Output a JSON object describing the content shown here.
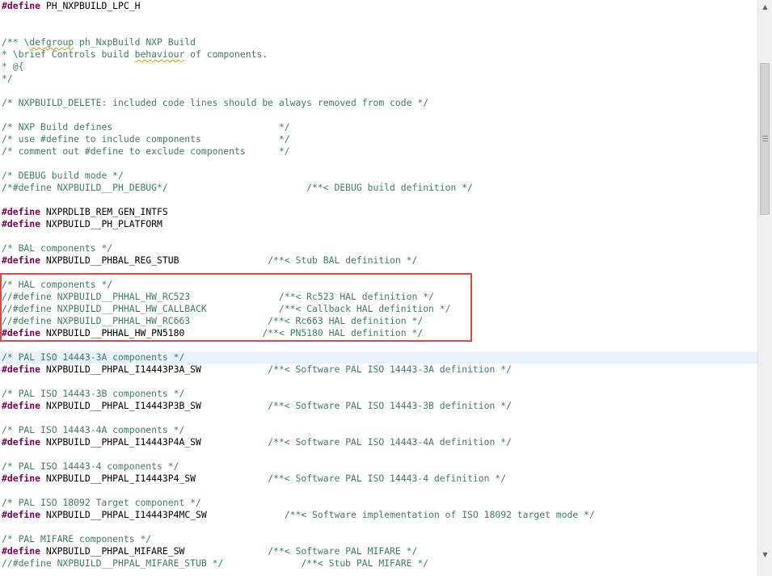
{
  "lines": [
    [
      {
        "t": "#define",
        "c": "kw"
      },
      {
        "t": " PH_NXPBUILD_LPC_H",
        "c": "id"
      }
    ],
    [],
    [],
    [
      {
        "t": "/** \\",
        "c": "cm"
      },
      {
        "t": "defgroup",
        "c": "cm",
        "sq": true
      },
      {
        "t": " ph_NxpBuild NXP Build",
        "c": "cm"
      }
    ],
    [
      {
        "t": "* \\brief Controls build ",
        "c": "cm"
      },
      {
        "t": "behaviour",
        "c": "cm",
        "sq": true
      },
      {
        "t": " of components.",
        "c": "cm"
      }
    ],
    [
      {
        "t": "* @{",
        "c": "cm"
      }
    ],
    [
      {
        "t": "*/",
        "c": "cm"
      }
    ],
    [],
    [
      {
        "t": "/* NXPBUILD_DELETE: included code lines should be always removed from code */",
        "c": "cm"
      }
    ],
    [],
    [
      {
        "t": "/* NXP Build defines                              */",
        "c": "cm"
      }
    ],
    [
      {
        "t": "/* use #define to include components              */",
        "c": "cm"
      }
    ],
    [
      {
        "t": "/* comment out #define to exclude components      */",
        "c": "cm"
      }
    ],
    [],
    [
      {
        "t": "/* DEBUG build mode */",
        "c": "cm"
      }
    ],
    [
      {
        "t": "/*#define NXPBUILD__PH_DEBUG*/                         /**< DEBUG build definition */",
        "c": "cm"
      }
    ],
    [],
    [
      {
        "t": "#define",
        "c": "kw"
      },
      {
        "t": " NXPRDLIB_REM_GEN_INTFS",
        "c": "id"
      }
    ],
    [
      {
        "t": "#define",
        "c": "kw"
      },
      {
        "t": " NXPBUILD__PH_PLATFORM",
        "c": "id"
      }
    ],
    [],
    [
      {
        "t": "/* BAL components */",
        "c": "cm"
      }
    ],
    [
      {
        "t": "#define",
        "c": "kw"
      },
      {
        "t": " NXPBUILD__PHBAL_REG_STUB                ",
        "c": "id"
      },
      {
        "t": "/**< Stub BAL definition */",
        "c": "cm"
      }
    ],
    [],
    [
      {
        "t": "/* HAL components */",
        "c": "cm"
      }
    ],
    [
      {
        "t": "//#define NXPBUILD__PHHAL_HW_RC523                /**< Rc523 HAL definition */",
        "c": "cm"
      }
    ],
    [
      {
        "t": "//#define NXPBUILD__PHHAL_HW_CALLBACK             /**< Callback HAL definition */",
        "c": "cm"
      }
    ],
    [
      {
        "t": "//#define NXPBUILD__PHHAL_HW_RC663              /**< Rc663 HAL definition */",
        "c": "cm"
      }
    ],
    [
      {
        "t": "#define",
        "c": "kw"
      },
      {
        "t": " NXPBUILD__PHHAL_HW_PN5180              ",
        "c": "id"
      },
      {
        "t": "/**< PN5180 HAL definition */",
        "c": "cm"
      }
    ],
    [],
    [
      {
        "t": "/* PAL ISO 14443-3A components */",
        "c": "cm"
      }
    ],
    [
      {
        "t": "#define",
        "c": "kw"
      },
      {
        "t": " NXPBUILD__PHPAL_I14443P3A_SW            ",
        "c": "id"
      },
      {
        "t": "/**< Software PAL ISO 14443-3A definition */",
        "c": "cm"
      }
    ],
    [],
    [
      {
        "t": "/* PAL ISO 14443-3B components */",
        "c": "cm"
      }
    ],
    [
      {
        "t": "#define",
        "c": "kw"
      },
      {
        "t": " NXPBUILD__PHPAL_I14443P3B_SW            ",
        "c": "id"
      },
      {
        "t": "/**< Software PAL ISO 14443-3B definition */",
        "c": "cm"
      }
    ],
    [],
    [
      {
        "t": "/* PAL ISO 14443-4A components */",
        "c": "cm"
      }
    ],
    [
      {
        "t": "#define",
        "c": "kw"
      },
      {
        "t": " NXPBUILD__PHPAL_I14443P4A_SW            ",
        "c": "id"
      },
      {
        "t": "/**< Software PAL ISO 14443-4A definition */",
        "c": "cm"
      }
    ],
    [],
    [
      {
        "t": "/* PAL ISO 14443-4 components */",
        "c": "cm"
      }
    ],
    [
      {
        "t": "#define",
        "c": "kw"
      },
      {
        "t": " NXPBUILD__PHPAL_I14443P4_SW             ",
        "c": "id"
      },
      {
        "t": "/**< Software PAL ISO 14443-4 definition */",
        "c": "cm"
      }
    ],
    [],
    [
      {
        "t": "/* PAL ISO 18092 Target component */",
        "c": "cm"
      }
    ],
    [
      {
        "t": "#define",
        "c": "kw"
      },
      {
        "t": " NXPBUILD__PHPAL_I14443P4MC_SW              ",
        "c": "id"
      },
      {
        "t": "/**< Software implementation of ISO 18092 target mode */",
        "c": "cm"
      }
    ],
    [],
    [
      {
        "t": "/* PAL MIFARE components */",
        "c": "cm"
      }
    ],
    [
      {
        "t": "#define",
        "c": "kw"
      },
      {
        "t": " NXPBUILD__PHPAL_MIFARE_SW               ",
        "c": "id"
      },
      {
        "t": "/**< Software PAL MIFARE */",
        "c": "cm"
      }
    ],
    [
      {
        "t": "//#define NXPBUILD__PHPAL_MIFARE_STUB */              /**< Stub PAL MIFARE */",
        "c": "cm"
      }
    ]
  ],
  "scrollbar": {
    "up_icon": "▲",
    "down_icon": "▼",
    "position": 0.13
  },
  "colors": {
    "keyword": "#7f0055",
    "comment": "#3f7f5f",
    "identifier": "#000000",
    "highlight_border": "#e0483e",
    "current_line": "#e8f2fe"
  }
}
